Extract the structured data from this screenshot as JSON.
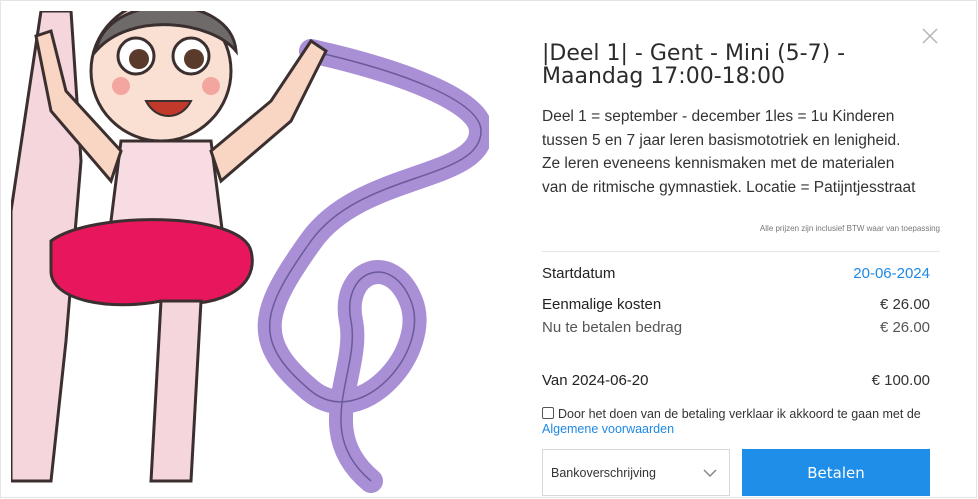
{
  "modal": {
    "title": "|Deel 1| - Gent - Mini (5-7) - Maandag 17:00-18:00",
    "description": "Deel 1 = september - december 1les = 1u Kinderen tussen 5 en 7 jaar leren basismototriek en lenigheid. Ze leren eveneens kennismaken met de materialen van de ritmische gymnastiek. Locatie = Patijntjesstraat",
    "vat_note": "Alle prijzen zijn inclusief BTW waar van toepassing",
    "close_icon": "close-icon",
    "illustration_icon": "gymnast-with-ribbon-illustration"
  },
  "details": {
    "start_label": "Startdatum",
    "start_value": "20-06-2024",
    "once_label": "Eenmalige kosten",
    "once_value": "€ 26.00",
    "now_label": "Nu te betalen bedrag",
    "now_value": "€ 26.00",
    "from_label": "Van 2024-06-20",
    "from_value": "€ 100.00"
  },
  "terms": {
    "checked": false,
    "text": "Door het doen van de betaling verklaar ik akkoord te gaan met de",
    "link": "Algemene voorwaarden"
  },
  "payment": {
    "method_selected": "Bankoverschrijving",
    "pay_label": "Betalen"
  },
  "colors": {
    "accent": "#1e8ee8",
    "link": "#1e88e5",
    "skirt": "#e8175d",
    "ribbon": "#a98fd6"
  }
}
